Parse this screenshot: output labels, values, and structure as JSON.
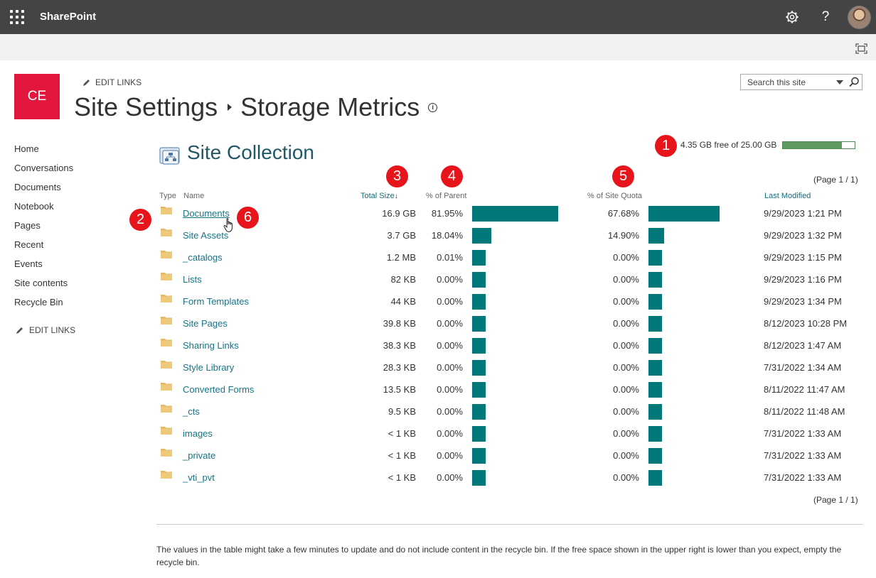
{
  "suitebar": {
    "app_name": "SharePoint",
    "icons": [
      "app-launcher-icon",
      "settings-gear-icon",
      "help-icon",
      "user-avatar"
    ],
    "help_glyph": "?"
  },
  "site": {
    "logo_text": "CE",
    "edit_links_label": "EDIT LINKS",
    "breadcrumb_parent": "Site Settings",
    "breadcrumb_current": "Storage Metrics",
    "search_placeholder": "Search this site"
  },
  "leftnav": {
    "items": [
      "Home",
      "Conversations",
      "Documents",
      "Notebook",
      "Pages",
      "Recent",
      "Events",
      "Site contents",
      "Recycle Bin"
    ],
    "edit_links_label": "EDIT LINKS"
  },
  "main": {
    "section_title": "Site Collection",
    "quota_text": "4.35 GB free of 25.00 GB",
    "quota_used_fraction": 0.826,
    "pager_top": "(Page 1 / 1)",
    "pager_bottom": "(Page 1 / 1)",
    "columns": {
      "type": "Type",
      "name": "Name",
      "total_size": "Total Size",
      "pct_parent": "% of Parent",
      "pct_quota": "% of Site Quota",
      "last_modified": "Last Modified"
    },
    "rows": [
      {
        "name": "Documents",
        "size": "16.9 GB",
        "pct_parent": "81.95%",
        "parent_value": 81.95,
        "pct_quota": "67.68%",
        "quota_value": 67.68,
        "modified": "9/29/2023 1:21 PM"
      },
      {
        "name": "Site Assets",
        "size": "3.7 GB",
        "pct_parent": "18.04%",
        "parent_value": 18.04,
        "pct_quota": "14.90%",
        "quota_value": 14.9,
        "modified": "9/29/2023 1:32 PM"
      },
      {
        "name": "_catalogs",
        "size": "1.2 MB",
        "pct_parent": "0.01%",
        "parent_value": 0.01,
        "pct_quota": "0.00%",
        "quota_value": 0,
        "modified": "9/29/2023 1:15 PM"
      },
      {
        "name": "Lists",
        "size": "82 KB",
        "pct_parent": "0.00%",
        "parent_value": 0,
        "pct_quota": "0.00%",
        "quota_value": 0,
        "modified": "9/29/2023 1:16 PM"
      },
      {
        "name": "Form Templates",
        "size": "44 KB",
        "pct_parent": "0.00%",
        "parent_value": 0,
        "pct_quota": "0.00%",
        "quota_value": 0,
        "modified": "9/29/2023 1:34 PM"
      },
      {
        "name": "Site Pages",
        "size": "39.8 KB",
        "pct_parent": "0.00%",
        "parent_value": 0,
        "pct_quota": "0.00%",
        "quota_value": 0,
        "modified": "8/12/2023 10:28 PM"
      },
      {
        "name": "Sharing Links",
        "size": "38.3 KB",
        "pct_parent": "0.00%",
        "parent_value": 0,
        "pct_quota": "0.00%",
        "quota_value": 0,
        "modified": "8/12/2023 1:47 AM"
      },
      {
        "name": "Style Library",
        "size": "28.3 KB",
        "pct_parent": "0.00%",
        "parent_value": 0,
        "pct_quota": "0.00%",
        "quota_value": 0,
        "modified": "7/31/2022 1:34 AM"
      },
      {
        "name": "Converted Forms",
        "size": "13.5 KB",
        "pct_parent": "0.00%",
        "parent_value": 0,
        "pct_quota": "0.00%",
        "quota_value": 0,
        "modified": "8/11/2022 11:47 AM"
      },
      {
        "name": "_cts",
        "size": "9.5 KB",
        "pct_parent": "0.00%",
        "parent_value": 0,
        "pct_quota": "0.00%",
        "quota_value": 0,
        "modified": "8/11/2022 11:48 AM"
      },
      {
        "name": "images",
        "size": "< 1 KB",
        "pct_parent": "0.00%",
        "parent_value": 0,
        "pct_quota": "0.00%",
        "quota_value": 0,
        "modified": "7/31/2022 1:33 AM"
      },
      {
        "name": "_private",
        "size": "< 1 KB",
        "pct_parent": "0.00%",
        "parent_value": 0,
        "pct_quota": "0.00%",
        "quota_value": 0,
        "modified": "7/31/2022 1:33 AM"
      },
      {
        "name": "_vti_pvt",
        "size": "< 1 KB",
        "pct_parent": "0.00%",
        "parent_value": 0,
        "pct_quota": "0.00%",
        "quota_value": 0,
        "modified": "7/31/2022 1:33 AM"
      }
    ],
    "footnote": "The values in the table might take a few minutes to update and do not include content in the recycle bin. If the free space shown in the upper right is lower than you expect, empty the recycle bin."
  },
  "annotations": {
    "badges": [
      "1",
      "2",
      "3",
      "4",
      "5",
      "6"
    ]
  },
  "colors": {
    "suitebar": "#444444",
    "logo": "#e3173e",
    "bar": "#00787a",
    "link": "#167487",
    "badge": "#e8141b",
    "quota_bar": "#5f9b60"
  }
}
